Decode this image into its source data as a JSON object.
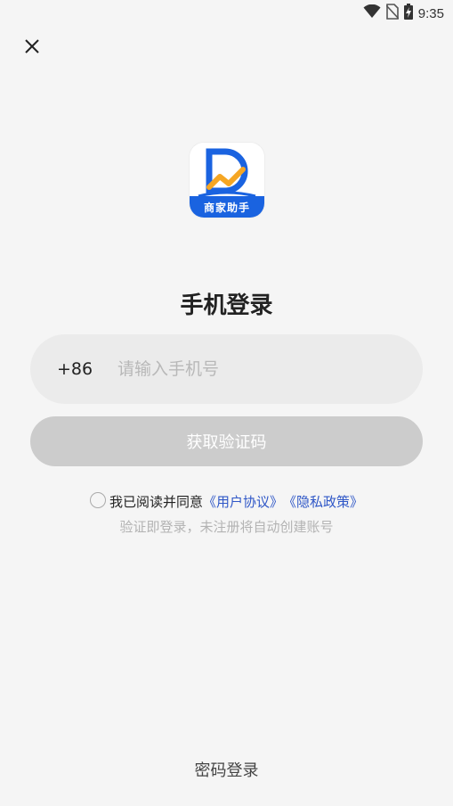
{
  "status_bar": {
    "time": "9:35",
    "icons": [
      "wifi-icon",
      "no-sim-icon",
      "battery-charging-icon"
    ]
  },
  "logo": {
    "icon": "app-logo",
    "text": "商家助手",
    "brand_color": "#1a63e0",
    "accent_color": "#f5a623"
  },
  "title": "手机登录",
  "phone": {
    "country_code": "+86",
    "value": "",
    "placeholder": "请输入手机号"
  },
  "get_code_button": {
    "label": "获取验证码",
    "enabled": false,
    "color": "#cccccc"
  },
  "agreement": {
    "checked": false,
    "prefix": "我已阅读并同意",
    "user_agreement": "《用户协议》",
    "privacy_policy": "《隐私政策》",
    "note": "验证即登录，未注册将自动创建账号",
    "link_color": "#2f57c7"
  },
  "password_login": "密码登录",
  "close_icon": "close-icon"
}
